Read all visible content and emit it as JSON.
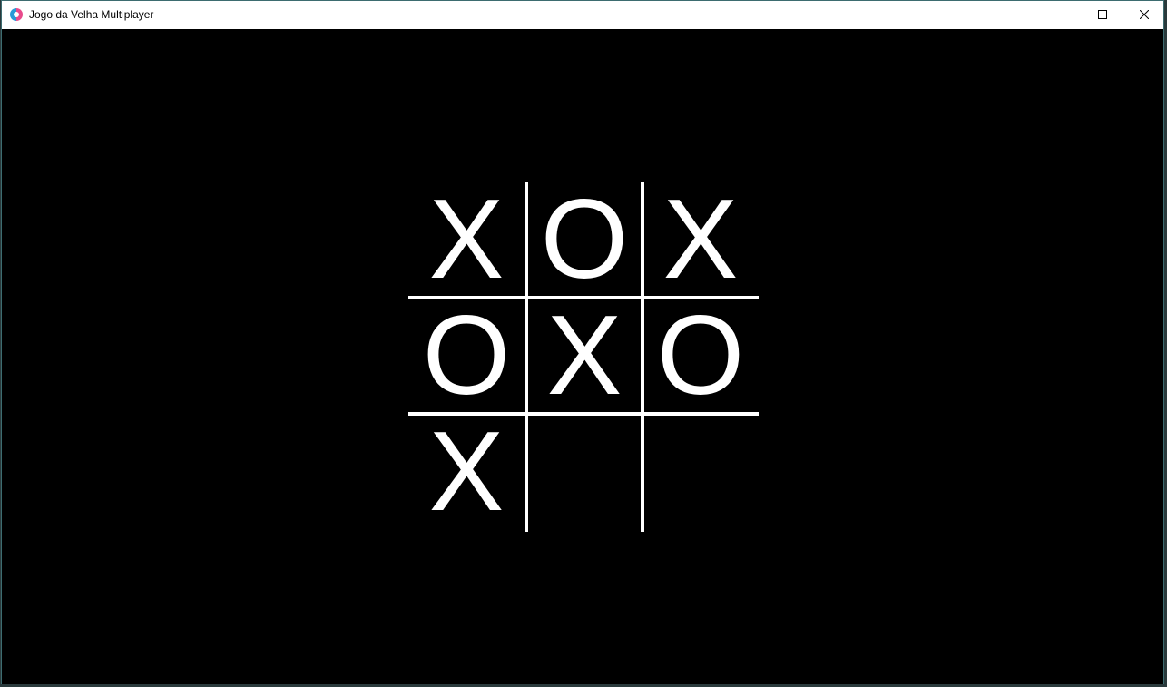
{
  "window": {
    "title": "Jogo da Velha Multiplayer",
    "icon": "app-icon"
  },
  "controls": {
    "minimize_icon": "minimize-icon",
    "maximize_icon": "maximize-icon",
    "close_icon": "close-icon"
  },
  "colors": {
    "background": "#000000",
    "marks": "#ffffff",
    "grid": "#ffffff"
  },
  "board": {
    "cells": [
      "X",
      "O",
      "X",
      "O",
      "X",
      "O",
      "X",
      "",
      ""
    ]
  }
}
